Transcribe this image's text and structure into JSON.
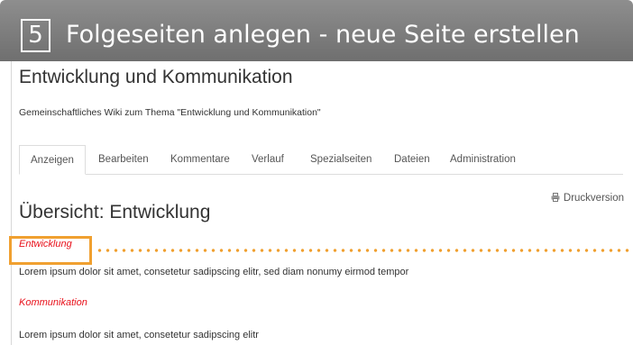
{
  "banner": {
    "step": "5",
    "title": "Folgeseiten anlegen - neue Seite erstellen"
  },
  "wiki": {
    "title": "Entwicklung und Kommunikation",
    "subtitle": "Gemeinschaftliches Wiki zum Thema \"Entwicklung und Kommunikation\""
  },
  "tabs": [
    {
      "label": "Anzeigen",
      "active": true
    },
    {
      "label": "Bearbeiten"
    },
    {
      "label": "Kommentare"
    },
    {
      "label": "Verlauf"
    },
    {
      "label": "Spezialseiten"
    },
    {
      "label": "Dateien"
    },
    {
      "label": "Administration"
    }
  ],
  "print_label": "Druckversion",
  "page": {
    "heading": "Übersicht: Entwicklung",
    "sections": [
      {
        "link": "Entwicklung",
        "text": "Lorem ipsum dolor sit amet, consetetur sadipscing elitr, sed diam nonumy eirmod tempor"
      },
      {
        "link": "Kommunikation",
        "text": "Lorem ipsum dolor sit amet, consetetur sadipscing elitr"
      }
    ]
  },
  "colors": {
    "banner": "#7a7a7a",
    "link": "#e8101a",
    "highlight": "#f0a030"
  }
}
